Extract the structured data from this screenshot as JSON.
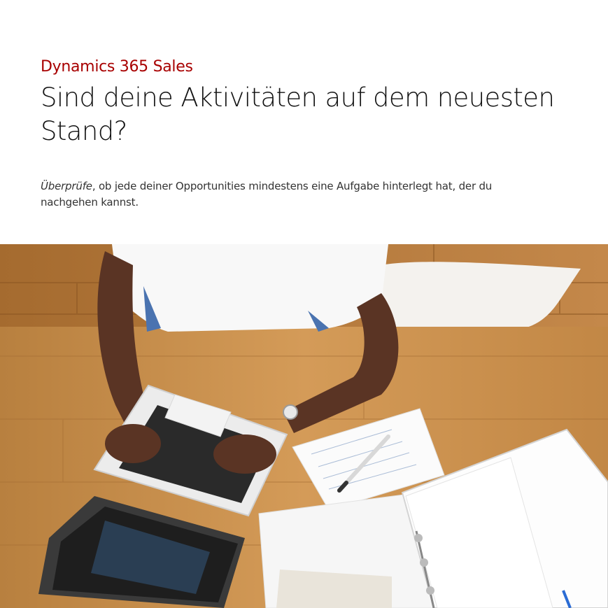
{
  "header": {
    "eyebrow": "Dynamics 365 Sales",
    "title": "Sind deine Aktivitäten auf dem neuesten Stand?"
  },
  "body": {
    "emphasis": "Überprüfe",
    "rest": ", ob jede deiner Opportunities mindestens eine Aufgabe hinterlegt hat, der du nachgehen kannst."
  },
  "colors": {
    "accent": "#a80000",
    "wood": "#c98f4e"
  }
}
